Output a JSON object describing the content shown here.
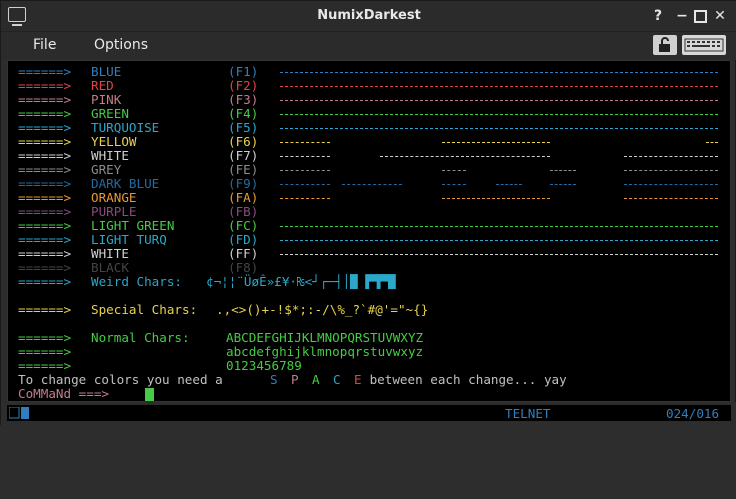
{
  "window": {
    "title": "NumixDarkest"
  },
  "menu": {
    "file": "File",
    "options": "Options"
  },
  "colors": {
    "blue": "#2f7fc0",
    "red": "#e04444",
    "pink": "#c47b8a",
    "green": "#44cc44",
    "turquoise": "#2aa7c9",
    "yellow": "#e8d24a",
    "white": "#d0d0d0",
    "grey": "#8c8c8c",
    "darkblue": "#246a9e",
    "orange": "#e89a30",
    "purple": "#8a4b7f",
    "lightgreen": "#44cc44",
    "lightturq": "#2aa7c9",
    "black": "#444444",
    "prompt": "#c47b8a"
  },
  "arrow": "======>",
  "color_lines": [
    {
      "name": "BLUE",
      "key": "(F1)",
      "color": "blue"
    },
    {
      "name": "RED",
      "key": "(F2)",
      "color": "red"
    },
    {
      "name": "PINK",
      "key": "(F3)",
      "color": "pink"
    },
    {
      "name": "GREEN",
      "key": "(F4)",
      "color": "green"
    },
    {
      "name": "TURQUOISE",
      "key": "(F5)",
      "color": "turquoise"
    },
    {
      "name": "YELLOW",
      "key": "(F6)",
      "color": "yellow"
    },
    {
      "name": "WHITE",
      "key": "(F7)",
      "color": "white"
    },
    {
      "name": "GREY",
      "key": "(FE)",
      "color": "grey"
    },
    {
      "name": "DARK BLUE",
      "key": "(F9)",
      "color": "darkblue"
    },
    {
      "name": "ORANGE",
      "key": "(FA)",
      "color": "orange"
    },
    {
      "name": "PURPLE",
      "key": "(FB)",
      "color": "purple"
    },
    {
      "name": "LIGHT GREEN",
      "key": "(FC)",
      "color": "lightgreen"
    },
    {
      "name": "LIGHT TURQ",
      "key": "(FD)",
      "color": "lightturq"
    },
    {
      "name": "WHITE",
      "key": "(FF)",
      "color": "white"
    },
    {
      "name": "BLACK",
      "key": "(F8)",
      "color": "black"
    }
  ],
  "weird": {
    "label": "Weird Chars:",
    "chars": "¢¬¦¦¨ÜøÊ»£¥·₨<┘┌─┤│█ ▛▜▀█"
  },
  "special": {
    "label": "Special Chars:",
    "chars": ".,<>()+-!$*;:-/\\%_?`#@'=\"~{}"
  },
  "normal": {
    "label": "Normal Chars:",
    "upper": "ABCDEFGHIJKLMNOPQRSTUVWXYZ",
    "lower": "abcdefghijklmnopqrstuvwxyz",
    "digits": "0123456789"
  },
  "instruction": {
    "before": "To change colors you need a ",
    "s": "S",
    "p": "P",
    "a": "A",
    "c": "C",
    "e": "E",
    "after": " between each change... yay"
  },
  "prompt": "CoMMaNd ===>",
  "status": {
    "protocol": "TELNET",
    "position": "024/016"
  }
}
